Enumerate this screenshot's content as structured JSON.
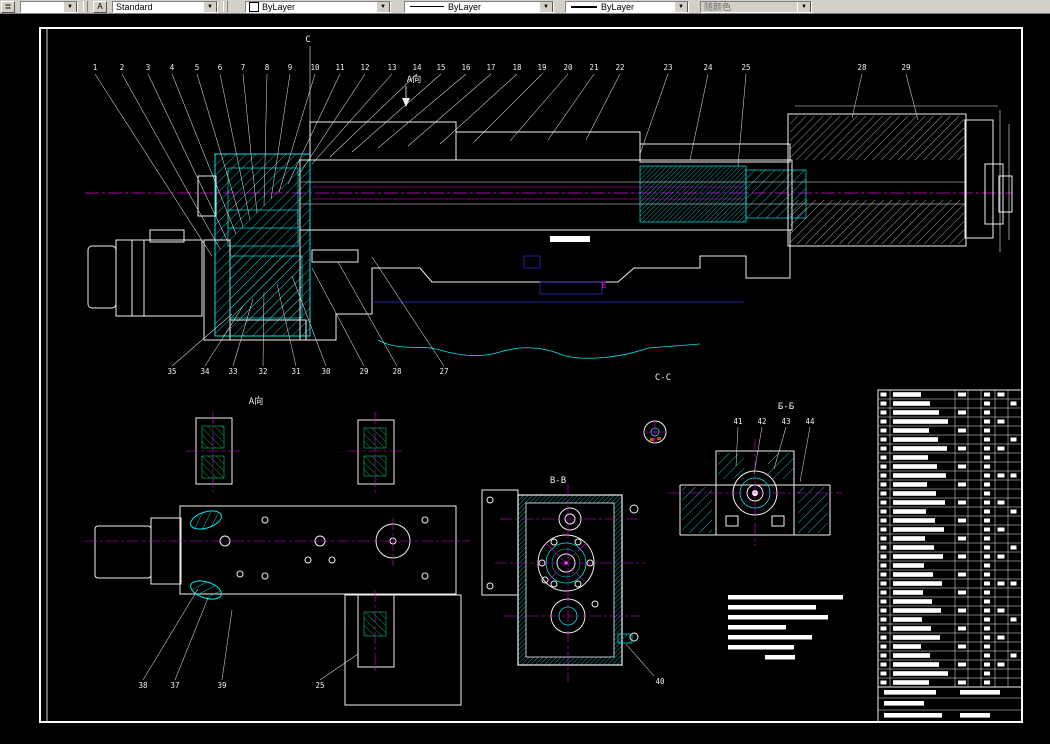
{
  "toolbar": {
    "layer_combo_value": "",
    "text_style_label": "Standard",
    "color_label": "ByLayer",
    "linetype_label": "ByLayer",
    "lineweight_label": "ByLayer",
    "plotstyle_label": "随颜色",
    "arrow_glyph": "▼",
    "text_style_icon_glyph": "A"
  },
  "drawing": {
    "labels": {
      "section_c": "C",
      "view_a_arrow": "A向",
      "view_a": "A向",
      "section_cc": "C-C",
      "section_bb_mid": "B-B",
      "section_bb_right": "Б-Б",
      "datum_e": "E"
    },
    "callouts": {
      "top": [
        "1",
        "2",
        "3",
        "4",
        "5",
        "6",
        "7",
        "8",
        "9",
        "10",
        "11",
        "12",
        "13",
        "14",
        "15",
        "16",
        "17",
        "18",
        "19",
        "20",
        "21",
        "22",
        "23",
        "24",
        "25",
        "28",
        "29"
      ],
      "bottom": [
        "35",
        "34",
        "33",
        "32",
        "31",
        "30",
        "29",
        "28",
        "27"
      ],
      "a_view": [
        "38",
        "37",
        "39",
        "25"
      ],
      "mid_view": [
        "40"
      ],
      "bb_view": [
        "41",
        "42",
        "43",
        "44"
      ]
    }
  },
  "bom": {
    "rows": 33,
    "title_rows": 3
  },
  "colors": {
    "outline": "#f0f0f0",
    "hatch_cyan": "#00e5e5",
    "centerline_magenta": "#e000e0",
    "hidden_blue": "#2a2ad0",
    "slot_green": "#00c060",
    "toolbar_bg": "#d4d0c8"
  }
}
